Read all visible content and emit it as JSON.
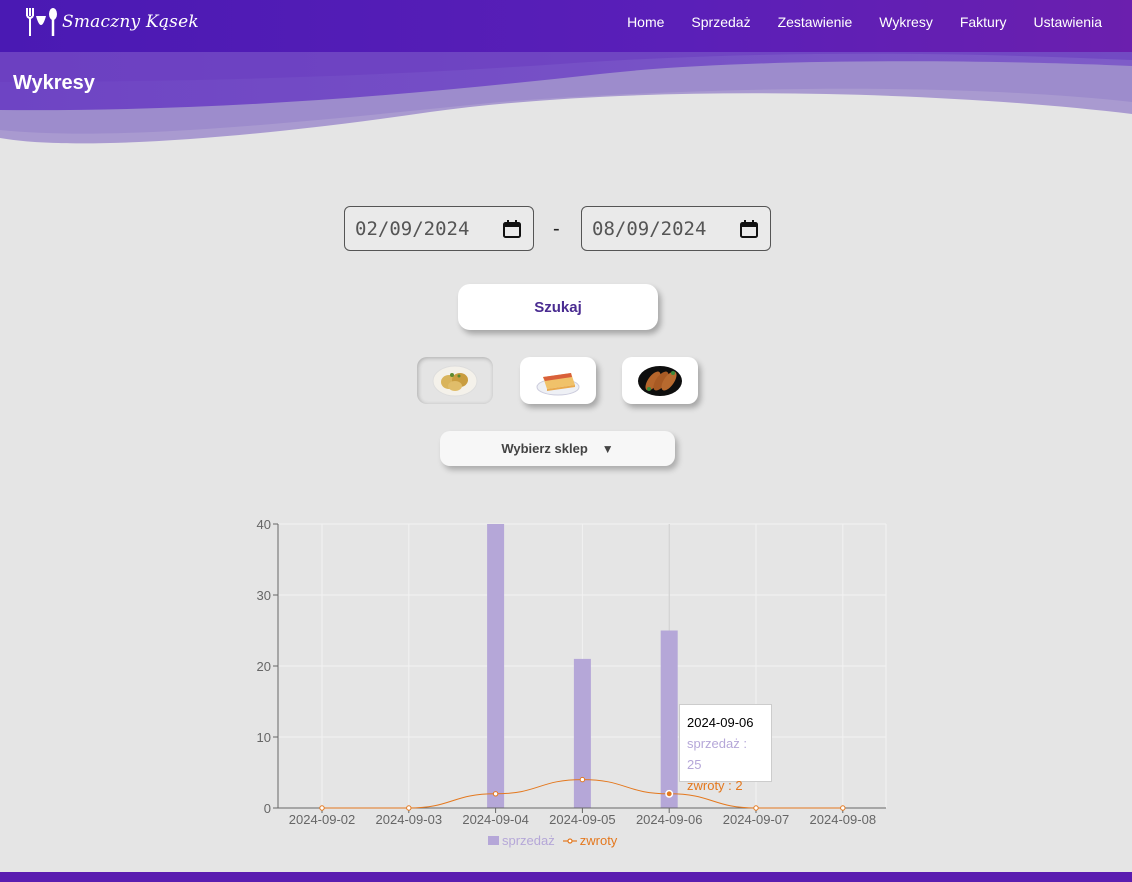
{
  "app": {
    "logo_text": "Smaczny Kąsek"
  },
  "nav": {
    "items": [
      "Home",
      "Sprzedaż",
      "Zestawienie",
      "Wykresy",
      "Faktury",
      "Ustawienia"
    ]
  },
  "page": {
    "title": "Wykresy"
  },
  "filters": {
    "date_from": "02/09/2024",
    "separator": "-",
    "date_to": "08/09/2024",
    "search_label": "Szukaj",
    "store_select_label": "Wybierz sklep",
    "store_select_arrow": "▼",
    "food_buttons": [
      {
        "icon": "potatoes-icon",
        "active": true
      },
      {
        "icon": "casserole-icon",
        "active": false
      },
      {
        "icon": "sausages-icon",
        "active": false
      }
    ]
  },
  "colors": {
    "nav_bg": "#4a19b3",
    "accent": "#4a2c91",
    "sales_bar": "#b5a7d8",
    "returns_line": "#e4781e"
  },
  "chart_data": {
    "type": "bar",
    "categories": [
      "2024-09-02",
      "2024-09-03",
      "2024-09-04",
      "2024-09-05",
      "2024-09-06",
      "2024-09-07",
      "2024-09-08"
    ],
    "series": [
      {
        "name": "sprzedaż",
        "type": "bar",
        "values": [
          0,
          0,
          40,
          21,
          25,
          0,
          0
        ]
      },
      {
        "name": "zwroty",
        "type": "line",
        "values": [
          0,
          0,
          2,
          4,
          2,
          0,
          0
        ]
      }
    ],
    "ylim": [
      0,
      40
    ],
    "yticks": [
      0,
      10,
      20,
      30,
      40
    ],
    "grid": true,
    "legend": "bottom"
  },
  "tooltip": {
    "date": "2024-09-06",
    "sales_text": "sprzedaż : 25",
    "returns_text": "zwroty : 2"
  },
  "legend": {
    "sales_label": "sprzedaż",
    "returns_label": "zwroty"
  }
}
